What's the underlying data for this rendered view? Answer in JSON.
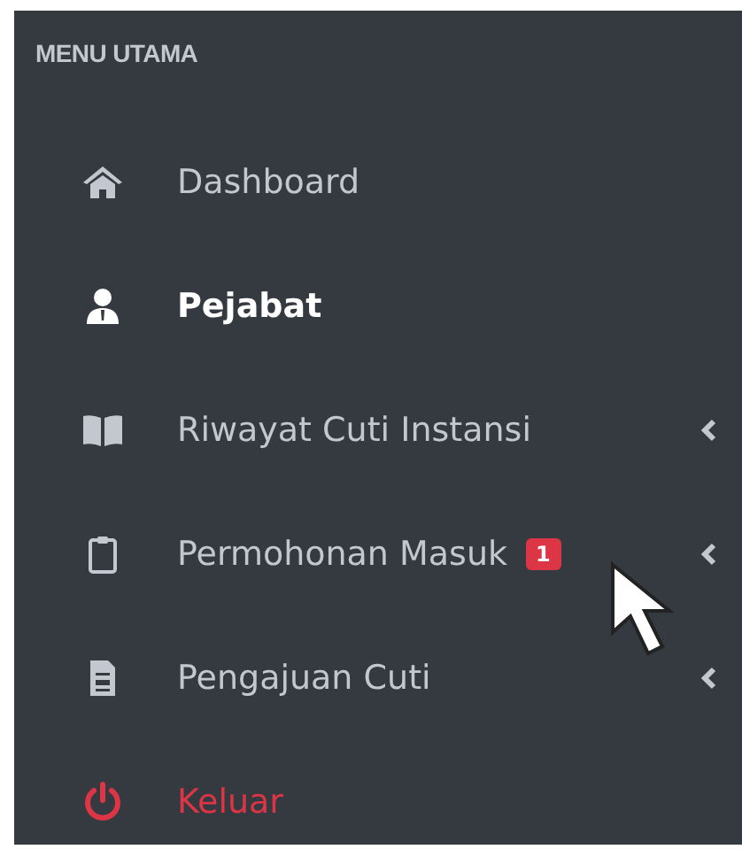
{
  "sidebar": {
    "header": "MENU UTAMA",
    "items": [
      {
        "label": "Dashboard",
        "kind": "link",
        "selected": false
      },
      {
        "label": "Pejabat",
        "kind": "link",
        "selected": true
      },
      {
        "label": "Riwayat Cuti Instansi",
        "kind": "submenu",
        "selected": false
      },
      {
        "label": "Permohonan Masuk",
        "kind": "submenu",
        "selected": false,
        "badge": "1"
      },
      {
        "label": "Pengajuan Cuti",
        "kind": "submenu",
        "selected": false
      },
      {
        "label": "Keluar",
        "kind": "logout",
        "selected": false
      }
    ]
  }
}
